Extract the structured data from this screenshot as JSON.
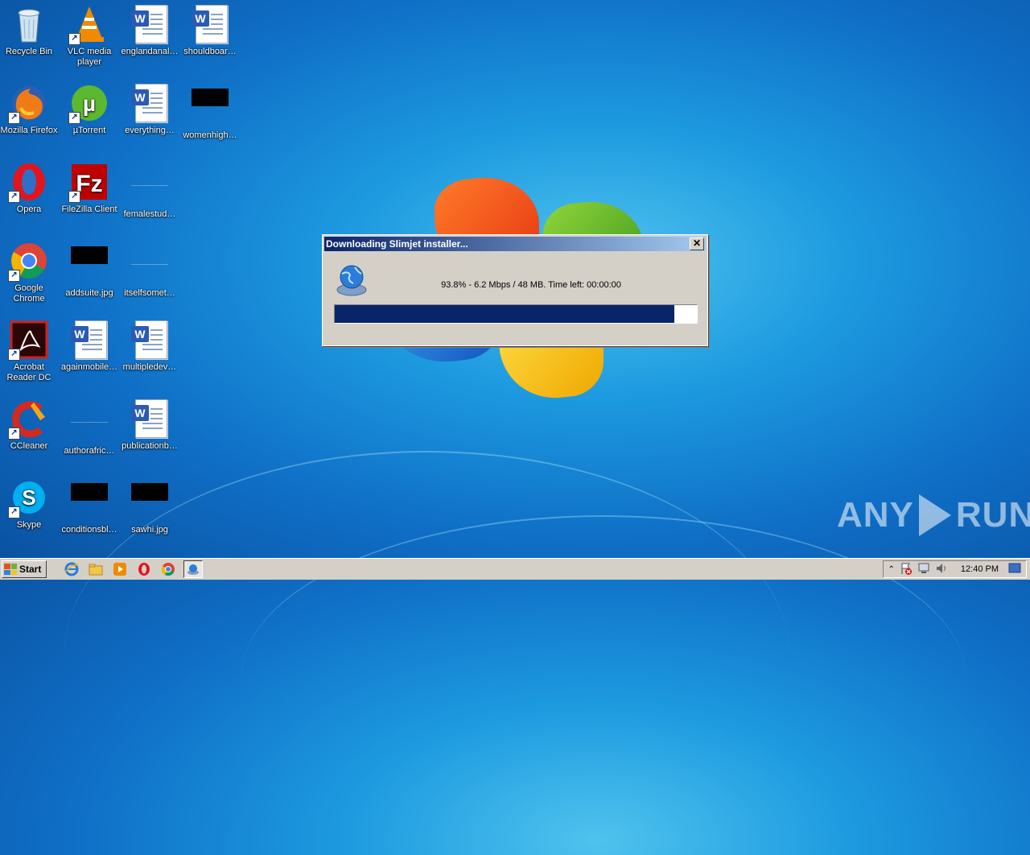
{
  "desktop": {
    "icons": [
      {
        "label": "Recycle Bin",
        "icon": "recycle-bin-icon"
      },
      {
        "label": "VLC media player",
        "icon": "vlc-icon"
      },
      {
        "label": "englandanal…",
        "icon": "word-doc-icon"
      },
      {
        "label": "shouldboar…",
        "icon": "word-doc-icon"
      },
      {
        "label": "Mozilla Firefox",
        "icon": "firefox-icon"
      },
      {
        "label": "µTorrent",
        "icon": "utorrent-icon"
      },
      {
        "label": "everything…",
        "icon": "word-doc-icon"
      },
      {
        "label": "womenhigh…",
        "icon": "image-file-icon"
      },
      {
        "label": "Opera",
        "icon": "opera-icon"
      },
      {
        "label": "FileZilla Client",
        "icon": "filezilla-icon"
      },
      {
        "label": "femalestud…",
        "icon": "file-icon"
      },
      {
        "label": "Google Chrome",
        "icon": "chrome-icon"
      },
      {
        "label": "addsuite.jpg",
        "icon": "image-file-icon"
      },
      {
        "label": "itselfsomet…",
        "icon": "file-icon"
      },
      {
        "label": "Acrobat Reader DC",
        "icon": "acrobat-icon"
      },
      {
        "label": "againmobile…",
        "icon": "word-doc-icon"
      },
      {
        "label": "multipledev…",
        "icon": "word-doc-icon"
      },
      {
        "label": "CCleaner",
        "icon": "ccleaner-icon"
      },
      {
        "label": "authorafric…",
        "icon": "file-icon"
      },
      {
        "label": "publicationb…",
        "icon": "word-doc-icon"
      },
      {
        "label": "Skype",
        "icon": "skype-icon"
      },
      {
        "label": "conditionsbl…",
        "icon": "image-file-icon"
      },
      {
        "label": "sawhi.jpg",
        "icon": "image-file-icon"
      }
    ]
  },
  "dialog": {
    "title": "Downloading Slimjet installer...",
    "close_label": "✕",
    "status": "93.8% - 6.2 Mbps / 48 MB. Time left: 00:00:00",
    "progress_fraction": 0.938
  },
  "taskbar": {
    "start_label": "Start",
    "quick_launch": [
      "internet-explorer-icon",
      "folder-icon",
      "media-player-icon",
      "opera-icon",
      "chrome-icon",
      "installer-icon"
    ],
    "tray_icons": [
      "chevron-up-icon",
      "flag-alert-icon",
      "network-icon",
      "volume-icon"
    ],
    "clock": "12:40 PM"
  },
  "watermark": "ANY RUN",
  "colors": {
    "title_gradient_start": "#0a246a",
    "title_gradient_end": "#a6caf0",
    "progress_fill": "#0a246a",
    "dialog_face": "#d4d0c8"
  }
}
